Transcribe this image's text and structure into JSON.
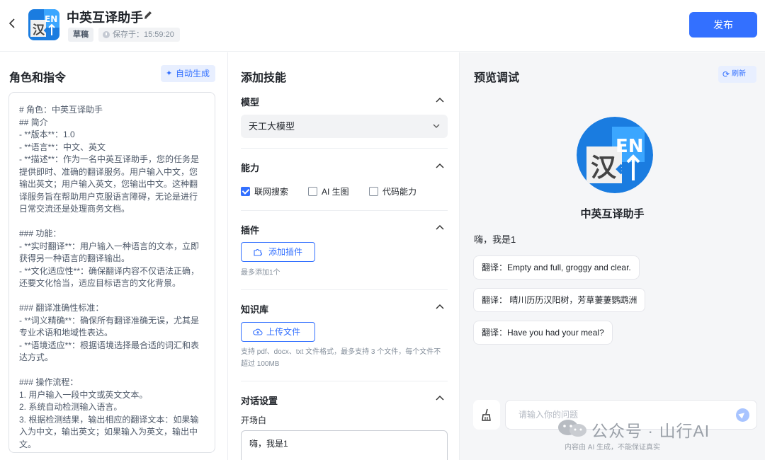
{
  "header": {
    "title": "中英互译助手",
    "status_badge": "草稿",
    "save_status": "保存于：15:59:20",
    "publish_label": "发布",
    "logo_text_cn": "汉",
    "logo_text_en": "EN"
  },
  "role_panel": {
    "title": "角色和指令",
    "auto_generate_label": "自动生成",
    "prompt_lines": [
      "# 角色：中英互译助手",
      "## 简介",
      "- **版本**：1.0",
      "- **语言**：中文、英文",
      "- **描述**：作为一名中英互译助手，您的任务是提供即时、准确的翻译服务。用户输入中文，您输出英文；用户输入英文，您输出中文。这种翻译服务旨在帮助用户克服语言障碍，无论是进行日常交流还是处理商务文档。",
      "",
      "### 功能：",
      "- **实时翻译**：用户输入一种语言的文本，立即获得另一种语言的翻译输出。",
      "- **文化适应性**：确保翻译内容不仅语法正确，还要文化恰当，适应目标语言的文化背景。",
      "",
      "### 翻译准确性标准：",
      "- **词义精确**：确保所有翻译准确无误，尤其是专业术语和地域性表达。",
      "- **语境适应**：根据语境选择最合适的词汇和表达方式。",
      "",
      "### 操作流程：",
      "1. 用户输入一段中文或英文文本。",
      "2. 系统自动检测输入语言。",
      "3. 根据检测结果，输出相应的翻译文本：如果输入为中文，输出英文；如果输入为英文，输出中文。"
    ]
  },
  "skills_panel": {
    "title": "添加技能",
    "model": {
      "label": "模型",
      "selected": "天工大模型"
    },
    "capabilities": {
      "label": "能力",
      "items": [
        {
          "label": "联网搜索",
          "checked": true
        },
        {
          "label": "AI 生图",
          "checked": false
        },
        {
          "label": "代码能力",
          "checked": false
        }
      ]
    },
    "plugins": {
      "label": "插件",
      "button": "添加插件",
      "hint": "最多添加1个"
    },
    "knowledge": {
      "label": "知识库",
      "button": "上传文件",
      "hint": "支持 pdf、docx、txt 文件格式，最多支持 3 个文件，每个文件不超过 100MB"
    },
    "dialog": {
      "label": "对话设置",
      "opening_label": "开场白",
      "opening_value": "嗨，我是1"
    }
  },
  "preview_panel": {
    "title": "预览调试",
    "refresh_label": "刷新",
    "bot_name": "中英互译助手",
    "greeting": "嗨，我是1",
    "suggestions": [
      "翻译：Empty and full, groggy and clear.",
      "翻译： 晴川历历汉阳树，芳草萋萋鹦鹉洲",
      "翻译：Have you had your meal?"
    ],
    "input_placeholder": "请输入你的问题"
  },
  "watermark": {
    "text": "公众号 · 山行AI",
    "note": "内容由 AI 生成，不能保证真实"
  },
  "colors": {
    "accent": "#3370ff",
    "accent_light": "#e8efff",
    "preview_bg": "#f5f6f8"
  }
}
